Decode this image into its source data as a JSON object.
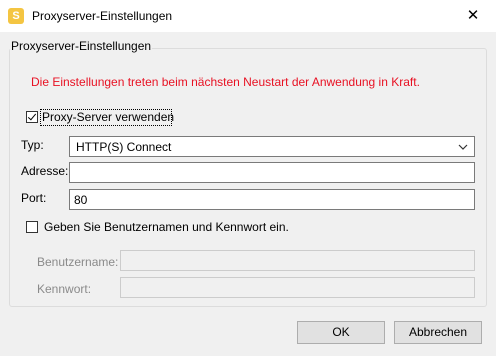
{
  "window": {
    "title": "Proxyserver-Einstellungen",
    "icon_letter": "S",
    "icon": "app-logo-icon",
    "close_glyph": "✕"
  },
  "group": {
    "legend": "Proxyserver-Einstellungen",
    "notice": "Die Einstellungen treten beim nächsten Neustart der Anwendung in Kraft.",
    "notice_color": "#e81123",
    "use_proxy": {
      "label": "Proxy-Server verwenden",
      "checked": true
    },
    "type": {
      "label": "Typ:",
      "value": "HTTP(S) Connect",
      "icon": "chevron-down-icon"
    },
    "address": {
      "label": "Adresse:",
      "value": ""
    },
    "port": {
      "label": "Port:",
      "value": "80"
    },
    "credentials": {
      "label": "Geben Sie Benutzernamen und Kennwort ein.",
      "checked": false
    },
    "username": {
      "label": "Benutzername:",
      "value": ""
    },
    "password": {
      "label": "Kennwort:",
      "value": ""
    }
  },
  "buttons": {
    "ok": "OK",
    "cancel": "Abbrechen"
  }
}
